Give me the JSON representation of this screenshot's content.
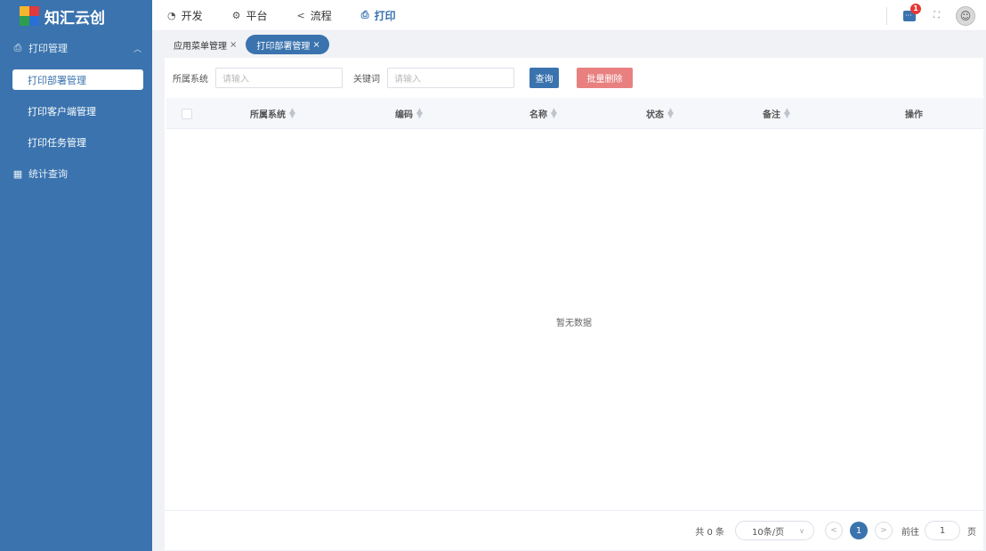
{
  "app": {
    "logo_text": "知汇云创"
  },
  "sidebar": {
    "groups": [
      {
        "label": "打印管理",
        "icon": "printer-icon",
        "expanded": true,
        "items": [
          {
            "label": "打印部署管理",
            "active": true
          },
          {
            "label": "打印客户端管理",
            "active": false
          },
          {
            "label": "打印任务管理",
            "active": false
          }
        ]
      },
      {
        "label": "统计查询",
        "icon": "clipboard-icon",
        "expanded": false,
        "items": []
      }
    ]
  },
  "topnav": [
    {
      "label": "开发",
      "icon": "dev-icon",
      "active": false
    },
    {
      "label": "平台",
      "icon": "gear-icon",
      "active": false
    },
    {
      "label": "流程",
      "icon": "share-icon",
      "active": false
    },
    {
      "label": "打印",
      "icon": "printer-icon",
      "active": true
    }
  ],
  "header": {
    "notification_count": "1"
  },
  "tabs": [
    {
      "label": "应用菜单管理",
      "active": false
    },
    {
      "label": "打印部署管理",
      "active": true
    }
  ],
  "filter": {
    "system_label": "所属系统",
    "system_placeholder": "请输入",
    "keyword_label": "关键词",
    "keyword_placeholder": "请输入",
    "query_button": "查询",
    "batch_delete_button": "批量删除"
  },
  "table": {
    "columns": [
      "所属系统",
      "编码",
      "名称",
      "状态",
      "备注",
      "操作"
    ],
    "empty_text": "暂无数据"
  },
  "pagination": {
    "total_text": "共 0 条",
    "page_size": "10条/页",
    "current_page": "1",
    "goto_label": "前往",
    "goto_value": "1",
    "page_suffix": "页"
  },
  "colors": {
    "primary": "#3a73ae",
    "danger": "#e88080",
    "badge": "#e53935"
  }
}
